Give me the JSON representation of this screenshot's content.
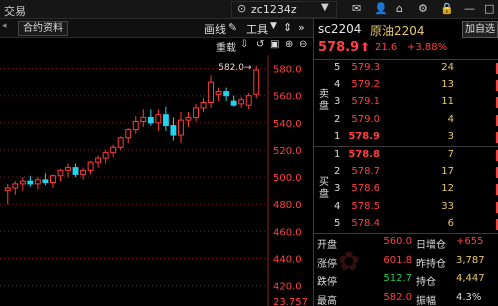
{
  "window": {
    "menu_label": "交易",
    "search_value": "zc1234z",
    "search_icon": "search-icon",
    "icons": [
      "mail-icon",
      "person-icon",
      "settings-icon",
      "minimize-icon"
    ]
  },
  "secbar": {
    "tab_label": "合约资料",
    "draw_label": "画线",
    "tools_label": "工具"
  },
  "chart_toolbar": {
    "overlay_label": "重载"
  },
  "chart_data": {
    "type": "candlestick",
    "ylim": [
      405,
      590
    ],
    "yticks": [
      580.0,
      560.0,
      540.0,
      520.0,
      500.0,
      480.0,
      460.0,
      440.0,
      420.0
    ],
    "bottom_label": "23.757",
    "max_annotation": "582.0",
    "candles": [
      {
        "o": 490,
        "h": 495,
        "l": 480,
        "c": 492
      },
      {
        "o": 492,
        "h": 497,
        "l": 487,
        "c": 495
      },
      {
        "o": 495,
        "h": 500,
        "l": 490,
        "c": 497
      },
      {
        "o": 497,
        "h": 501,
        "l": 493,
        "c": 495
      },
      {
        "o": 495,
        "h": 500,
        "l": 491,
        "c": 498
      },
      {
        "o": 498,
        "h": 503,
        "l": 494,
        "c": 496
      },
      {
        "o": 496,
        "h": 502,
        "l": 492,
        "c": 501
      },
      {
        "o": 501,
        "h": 506,
        "l": 497,
        "c": 505
      },
      {
        "o": 505,
        "h": 510,
        "l": 500,
        "c": 507
      },
      {
        "o": 507,
        "h": 510,
        "l": 500,
        "c": 502
      },
      {
        "o": 502,
        "h": 507,
        "l": 498,
        "c": 505
      },
      {
        "o": 505,
        "h": 512,
        "l": 502,
        "c": 511
      },
      {
        "o": 511,
        "h": 516,
        "l": 507,
        "c": 514
      },
      {
        "o": 514,
        "h": 520,
        "l": 510,
        "c": 518
      },
      {
        "o": 518,
        "h": 524,
        "l": 515,
        "c": 522
      },
      {
        "o": 522,
        "h": 530,
        "l": 520,
        "c": 529
      },
      {
        "o": 529,
        "h": 536,
        "l": 525,
        "c": 535
      },
      {
        "o": 535,
        "h": 545,
        "l": 532,
        "c": 541
      },
      {
        "o": 541,
        "h": 550,
        "l": 537,
        "c": 544
      },
      {
        "o": 544,
        "h": 550,
        "l": 538,
        "c": 540
      },
      {
        "o": 540,
        "h": 550,
        "l": 534,
        "c": 546
      },
      {
        "o": 546,
        "h": 552,
        "l": 534,
        "c": 538
      },
      {
        "o": 538,
        "h": 544,
        "l": 527,
        "c": 531
      },
      {
        "o": 531,
        "h": 548,
        "l": 525,
        "c": 542
      },
      {
        "o": 542,
        "h": 548,
        "l": 537,
        "c": 544
      },
      {
        "o": 544,
        "h": 554,
        "l": 541,
        "c": 551
      },
      {
        "o": 551,
        "h": 558,
        "l": 548,
        "c": 555
      },
      {
        "o": 555,
        "h": 575,
        "l": 551,
        "c": 570
      },
      {
        "o": 561,
        "h": 566,
        "l": 556,
        "c": 563
      },
      {
        "o": 563,
        "h": 566,
        "l": 556,
        "c": 560
      },
      {
        "o": 556,
        "h": 560,
        "l": 552,
        "c": 553
      },
      {
        "o": 554,
        "h": 559,
        "l": 551,
        "c": 557
      },
      {
        "o": 553,
        "h": 562,
        "l": 550,
        "c": 560
      },
      {
        "o": 561,
        "h": 582,
        "l": 558,
        "c": 579
      }
    ],
    "colors": {
      "up": "#ff3b3b",
      "down": "#22d3ee",
      "grid": "#7a1c1c"
    }
  },
  "quote": {
    "code": "sc2204",
    "name": "原油2204",
    "add_label": "加自选",
    "price": "578.9",
    "change": "21.6",
    "change_pct": "+3.88%"
  },
  "orderbook": {
    "sell_label": "卖盘",
    "buy_label": "买盘",
    "asks": [
      {
        "idx": "5",
        "price": "579.3",
        "vol": "24"
      },
      {
        "idx": "4",
        "price": "579.2",
        "vol": "13"
      },
      {
        "idx": "3",
        "price": "579.1",
        "vol": "11"
      },
      {
        "idx": "2",
        "price": "579.0",
        "vol": "4"
      },
      {
        "idx": "1",
        "price": "578.9",
        "vol": "3"
      }
    ],
    "bids": [
      {
        "idx": "1",
        "price": "578.8",
        "vol": "7"
      },
      {
        "idx": "2",
        "price": "578.7",
        "vol": "17"
      },
      {
        "idx": "3",
        "price": "578.6",
        "vol": "12"
      },
      {
        "idx": "4",
        "price": "578.5",
        "vol": "33"
      },
      {
        "idx": "5",
        "price": "578.4",
        "vol": "6"
      }
    ]
  },
  "stats": [
    {
      "l1": "开盘",
      "v1": "560.0",
      "c1": "#ff4040",
      "l2": "日增仓",
      "v2": "+655",
      "c2": "#ff4040"
    },
    {
      "l1": "涨停",
      "v1": "601.8",
      "c1": "#ff4040",
      "l2": "昨持仓",
      "v2": "3,787",
      "c2": "#e8c86a"
    },
    {
      "l1": "跌停",
      "v1": "512.7",
      "c1": "#22cc44",
      "l2": "持仓",
      "v2": "4,447",
      "c2": "#e8c86a"
    },
    {
      "l1": "最高",
      "v1": "582.0",
      "c1": "#ff4040",
      "l2": "振幅",
      "v2": "4.3%",
      "c2": "#ddd"
    }
  ]
}
